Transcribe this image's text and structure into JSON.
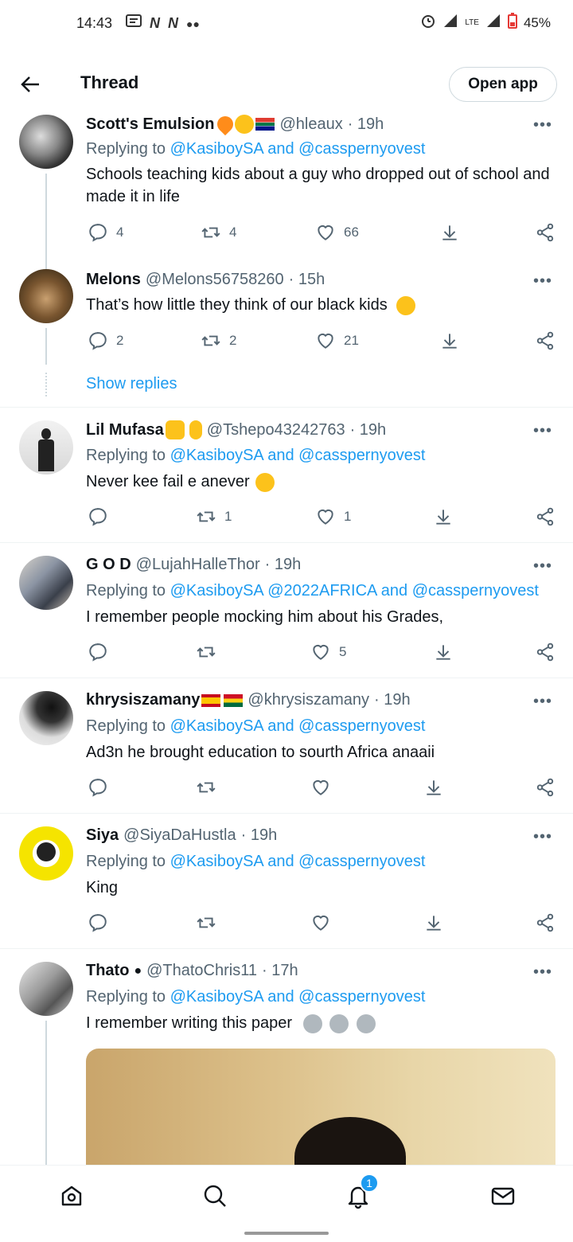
{
  "status_bar": {
    "time": "14:43",
    "battery": "45%",
    "network": "LTE"
  },
  "header": {
    "title": "Thread",
    "open_app": "Open app"
  },
  "tweets": [
    {
      "name": "Scott's Emulsion",
      "handle": "@hleaux",
      "time": "· 19h",
      "reply_prefix": "Replying to",
      "reply_to": "@KasiboySA and @casspernyovest",
      "text": "Schools teaching kids about a guy who dropped out of school and made it in life",
      "replies": "4",
      "retweets": "4",
      "likes": "66"
    },
    {
      "name": "Melons",
      "handle": "@Melons56758260",
      "time": "· 15h",
      "text": "That’s how little they think of our black kids",
      "replies": "2",
      "retweets": "2",
      "likes": "21",
      "show_replies": "Show replies"
    },
    {
      "name": "Lil Mufasa",
      "handle": "@Tshepo43242763",
      "time": "· 19h",
      "reply_prefix": "Replying to",
      "reply_to": "@KasiboySA and @casspernyovest",
      "text": "Never kee fail e anever",
      "replies": "",
      "retweets": "1",
      "likes": "1"
    },
    {
      "name": "G O D",
      "handle": "@LujahHalleThor",
      "time": "· 19h",
      "reply_prefix": "Replying to",
      "reply_to": "@KasiboySA @2022AFRICA and @casspernyovest",
      "text": "I remember people mocking him about his Grades,",
      "replies": "",
      "retweets": "",
      "likes": "5"
    },
    {
      "name": "khrysiszamany",
      "handle": "@khrysiszamany",
      "time": "· 19h",
      "reply_prefix": "Replying to",
      "reply_to": "@KasiboySA and @casspernyovest",
      "text": "Ad3n he brought education to sourth Africa anaaii",
      "replies": "",
      "retweets": "",
      "likes": ""
    },
    {
      "name": "Siya",
      "handle": "@SiyaDaHustla",
      "time": "· 19h",
      "reply_prefix": "Replying to",
      "reply_to": "@KasiboySA and @casspernyovest",
      "text": "King",
      "replies": "",
      "retweets": "",
      "likes": ""
    },
    {
      "name": "Thato",
      "handle": "@ThatoChris11",
      "time": "· 17h",
      "reply_prefix": "Replying to",
      "reply_to": "@KasiboySA and @casspernyovest",
      "text": "I remember writing this paper"
    }
  ],
  "nav": {
    "notification_count": "1"
  },
  "colors": {
    "link": "#1d9bf0",
    "muted": "#536471",
    "text": "#0f1419"
  }
}
